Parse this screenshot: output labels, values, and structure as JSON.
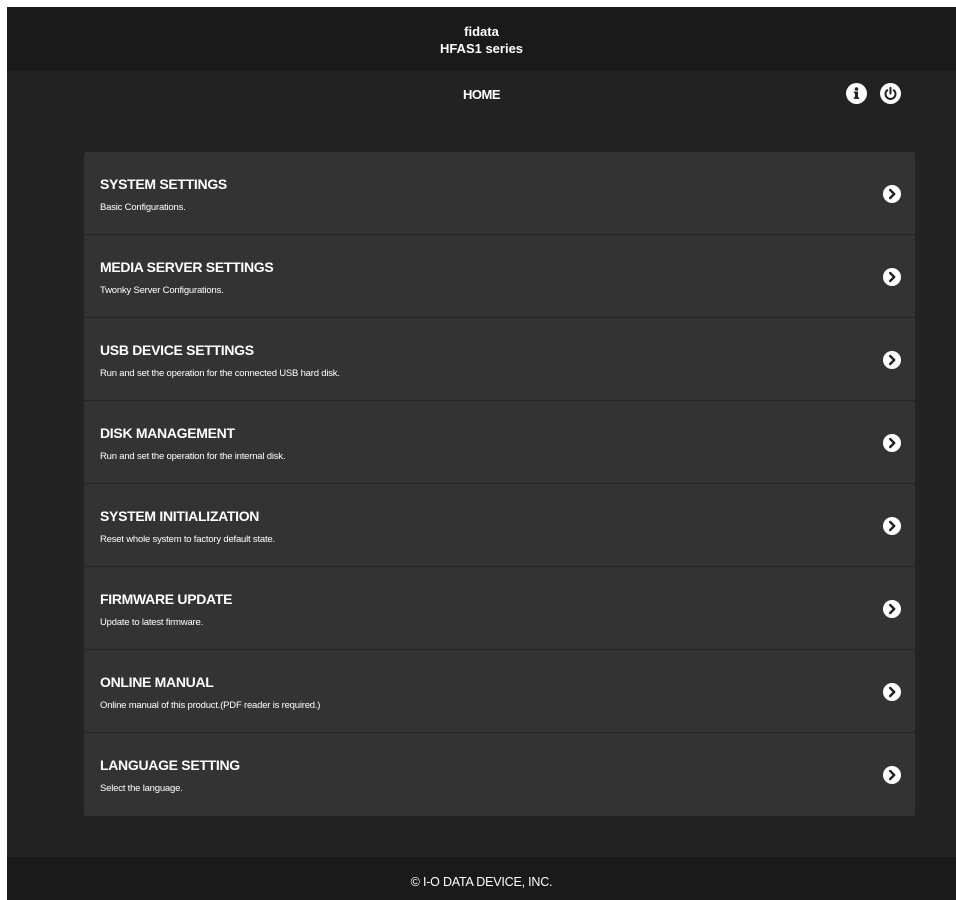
{
  "brand": {
    "line1": "fidata",
    "line2": "HFAS1 series"
  },
  "header": {
    "title": "HOME",
    "info_icon": "info-circle-icon",
    "power_icon": "power-icon"
  },
  "menu": {
    "items": [
      {
        "title": "SYSTEM SETTINGS",
        "description": "Basic Configurations."
      },
      {
        "title": "MEDIA SERVER SETTINGS",
        "description": "Twonky Server Configurations."
      },
      {
        "title": "USB DEVICE SETTINGS",
        "description": "Run and set the operation for the connected USB hard disk."
      },
      {
        "title": "DISK MANAGEMENT",
        "description": "Run and set the operation for the internal disk."
      },
      {
        "title": "SYSTEM INITIALIZATION",
        "description": "Reset whole system to factory default state."
      },
      {
        "title": "FIRMWARE UPDATE",
        "description": "Update to latest firmware."
      },
      {
        "title": "ONLINE MANUAL",
        "description": "Online manual of this product.(PDF reader is required.)"
      },
      {
        "title": "LANGUAGE SETTING",
        "description": "Select the language."
      }
    ],
    "chevron_icon": "chevron-right-circle-icon"
  },
  "footer": {
    "copyright": "© I-O DATA DEVICE, INC."
  },
  "colors": {
    "page_background": "#232323",
    "bar_background": "#1a1a1a",
    "card_background": "#333333",
    "text": "#ffffff"
  }
}
